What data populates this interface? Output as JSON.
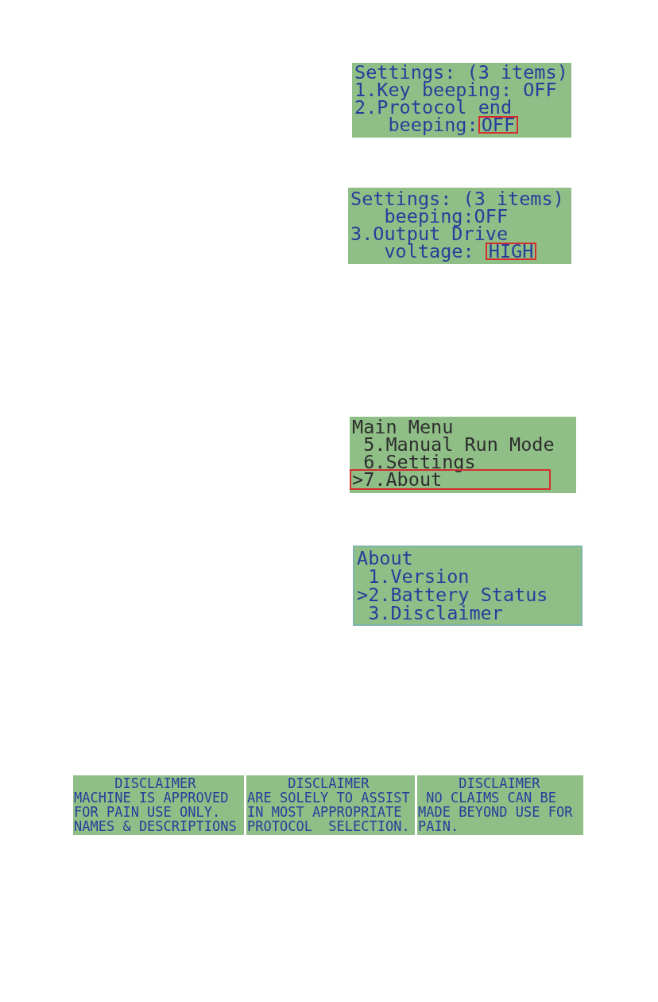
{
  "screens": [
    {
      "color": "#2a3c9c",
      "lines": [
        {
          "text": "Settings: (3 items)",
          "highlighted": false
        },
        {
          "text": "1.Key beeping: OFF",
          "highlighted": false
        },
        {
          "text": "2.Protocol end",
          "highlighted": false
        },
        {
          "text": "   beeping:",
          "value": "OFF",
          "highlighted": true
        }
      ]
    },
    {
      "color": "#2a3c9c",
      "lines": [
        {
          "text": "Settings: (3 items)",
          "highlighted": false
        },
        {
          "text": "   beeping:OFF",
          "highlighted": false
        },
        {
          "text": "3.Output Drive",
          "highlighted": false
        },
        {
          "text": "   voltage: ",
          "value": "HIGH",
          "highlighted": true
        }
      ]
    },
    {
      "color": "#2e2e2e",
      "lines": [
        {
          "text": "Main Menu",
          "highlighted": false
        },
        {
          "text": " 5.Manual Run Mode",
          "highlighted": false
        },
        {
          "text": " 6.Settings",
          "highlighted": false
        },
        {
          "text": ">7.About",
          "highlighted": true
        }
      ]
    },
    {
      "color": "#2a3c9c",
      "lines": [
        {
          "text": "About",
          "highlighted": false
        },
        {
          "text": " 1.Version",
          "highlighted": false
        },
        {
          "text": ">2.Battery Status",
          "highlighted": false
        },
        {
          "text": " 3.Disclaimer",
          "highlighted": false
        }
      ]
    }
  ],
  "disclaimer_screens": [
    {
      "lines": [
        "     DISCLAIMER",
        "MACHINE IS APPROVED",
        "FOR PAIN USE ONLY.",
        "NAMES & DESCRIPTIONS"
      ]
    },
    {
      "lines": [
        "     DISCLAIMER",
        "ARE SOLELY TO ASSIST",
        "IN MOST APPROPRIATE",
        "PROTOCOL  SELECTION."
      ]
    },
    {
      "lines": [
        "     DISCLAIMER",
        " NO CLAIMS CAN BE",
        "MADE BEYOND USE FOR",
        "PAIN."
      ]
    }
  ]
}
